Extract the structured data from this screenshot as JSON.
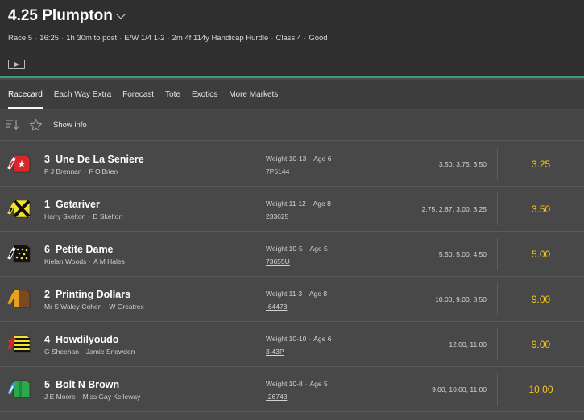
{
  "race": {
    "title": "4.25 Plumpton",
    "info": [
      "Race 5",
      "16:25",
      "1h 30m to post",
      "E/W 1/4 1-2",
      "2m 4f 114y Handicap Hurdle",
      "Class 4",
      "Good"
    ]
  },
  "tabs": [
    "Racecard",
    "Each Way Extra",
    "Forecast",
    "Tote",
    "Exotics",
    "More Markets"
  ],
  "toolbar": {
    "show_info": "Show info"
  },
  "colors": {
    "odds": "#f5c518",
    "accent": "#3a9d7a"
  },
  "runners": [
    {
      "number": "3",
      "name": "Une De La Seniere",
      "jockey": "P J Brennan",
      "trainer": "F O'Brien",
      "weight": "Weight 10-13",
      "age": "Age 6",
      "form": "7P5144",
      "history": "3.50, 3.75, 3.50",
      "odds": "3.25",
      "silk": "red-white-star"
    },
    {
      "number": "1",
      "name": "Getariver",
      "jockey": "Harry Skelton",
      "trainer": "D Skelton",
      "weight": "Weight 11-12",
      "age": "Age 8",
      "form": "233625",
      "history": "2.75, 2.87, 3.00, 3.25",
      "odds": "3.50",
      "silk": "yellow-black-cross"
    },
    {
      "number": "6",
      "name": "Petite Dame",
      "jockey": "Kielan Woods",
      "trainer": "A M Hales",
      "weight": "Weight 10-5",
      "age": "Age 5",
      "form": "73655U",
      "history": "5.50, 5.00, 4.50",
      "odds": "5.00",
      "silk": "black-yellow-spots"
    },
    {
      "number": "2",
      "name": "Printing Dollars",
      "jockey": "Mr S Waley-Cohen",
      "trainer": "W Greatrex",
      "weight": "Weight 11-3",
      "age": "Age 8",
      "form": "-64478",
      "history": "10.00, 9.00, 8.50",
      "odds": "9.00",
      "silk": "brown-orange"
    },
    {
      "number": "4",
      "name": "Howdilyoudo",
      "jockey": "G Sheehan",
      "trainer": "Jamie Snowden",
      "weight": "Weight 10-10",
      "age": "Age 6",
      "form": "3-43P",
      "history": "12.00, 11.00",
      "odds": "9.00",
      "silk": "yellow-black-hoops"
    },
    {
      "number": "5",
      "name": "Bolt N Brown",
      "jockey": "J E Moore",
      "trainer": "Miss Gay Kelleway",
      "weight": "Weight 10-8",
      "age": "Age 5",
      "form": "-26743",
      "history": "9.00, 10.00, 11.00",
      "odds": "10.00",
      "silk": "green-blue"
    }
  ]
}
